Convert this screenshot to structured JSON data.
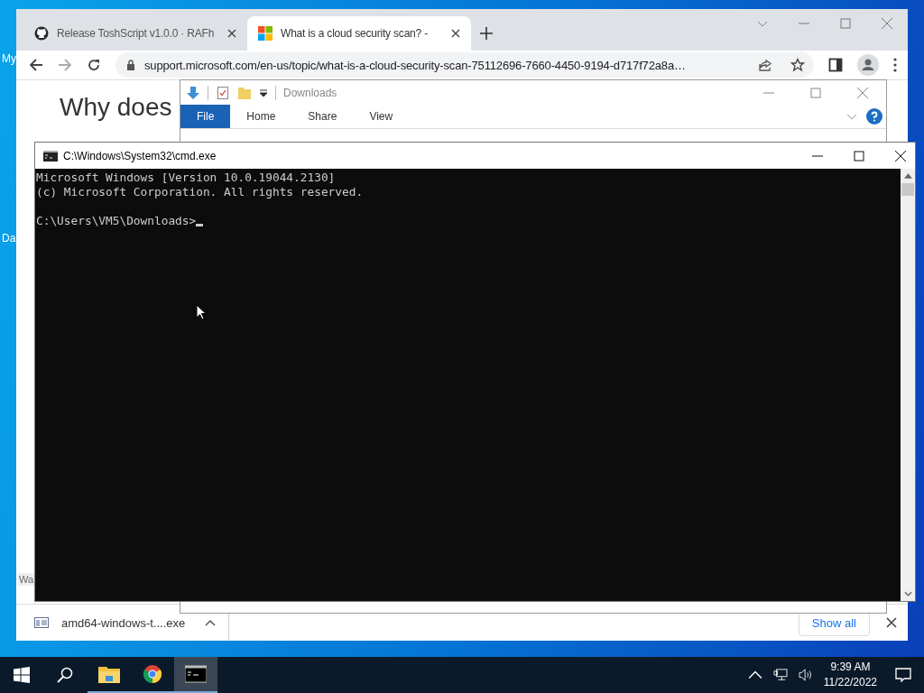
{
  "desktop": {
    "icon_labels": [
      "My",
      "Da"
    ]
  },
  "browser": {
    "tabs": [
      {
        "kind": "github",
        "title": "Release ToshScript v1.0.0 · RAFh",
        "selected": false
      },
      {
        "kind": "microsoft",
        "title": "What is a cloud security scan? -",
        "selected": true
      }
    ],
    "address": "support.microsoft.com/en-us/topic/what-is-a-cloud-security-scan-75112696-7660-4450-9194-d717f72a8a…",
    "page": {
      "heading": "Why does",
      "footer_text": "Wa"
    },
    "downloads_bar": {
      "file": "amd64-windows-t....exe",
      "show_all": "Show all"
    }
  },
  "explorer": {
    "title": "Downloads",
    "ribbon_tabs": [
      {
        "label": "File",
        "selected": true
      },
      {
        "label": "Home",
        "selected": false
      },
      {
        "label": "Share",
        "selected": false
      },
      {
        "label": "View",
        "selected": false
      }
    ]
  },
  "console": {
    "title": "C:\\Windows\\System32\\cmd.exe",
    "lines": [
      "Microsoft Windows [Version 10.0.19044.2130]",
      "(c) Microsoft Corporation. All rights reserved."
    ],
    "prompt": "C:\\Users\\VM5\\Downloads>"
  },
  "taskbar": {
    "apps": [
      {
        "kind": "explorer",
        "selected": false,
        "running": true
      },
      {
        "kind": "chrome",
        "selected": false,
        "running": true
      },
      {
        "kind": "cmd",
        "selected": true,
        "running": true
      }
    ],
    "time": "9:39 AM",
    "date": "11/22/2022"
  }
}
